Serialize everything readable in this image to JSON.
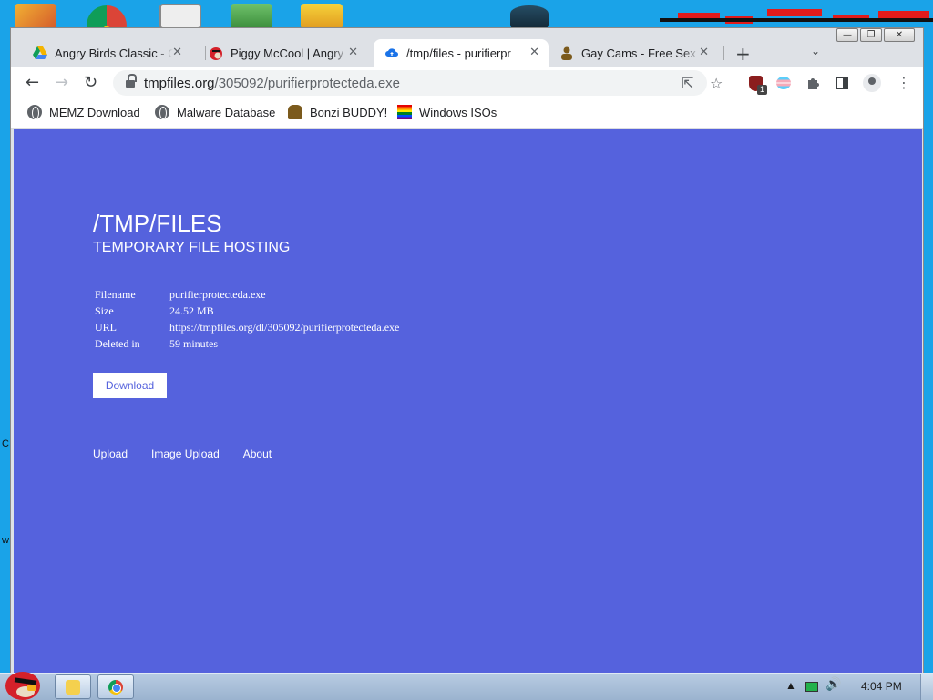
{
  "browser": {
    "tabs": [
      {
        "title": "Angry Birds Classic - G",
        "favicon": "google-drive-icon",
        "active": false
      },
      {
        "title": "Piggy McCool | Angry",
        "favicon": "red-bird-icon",
        "active": false
      },
      {
        "title": "/tmp/files - purifierpr",
        "favicon": "cloud-upload-icon",
        "active": true
      },
      {
        "title": "Gay Cams - Free Sex C",
        "favicon": "user-icon",
        "active": false
      }
    ],
    "close_glyph": "✕",
    "new_tab_glyph": "+",
    "tab_search_glyph": "⌄",
    "url_host": "tmpfiles.org",
    "url_path": "/305092/purifierprotecteda.exe",
    "bookmarks": [
      {
        "label": "MEMZ Download",
        "icon": "globe-icon"
      },
      {
        "label": "Malware Database",
        "icon": "globe-icon"
      },
      {
        "label": "Bonzi BUDDY!",
        "icon": "bonzi-icon"
      },
      {
        "label": "Windows ISOs",
        "icon": "rainbow-flag-icon"
      }
    ],
    "extension_badge": "1"
  },
  "page": {
    "title": "/TMP/FILES",
    "subtitle": "TEMPORARY FILE HOSTING",
    "info": [
      {
        "key": "Filename",
        "value": "purifierprotecteda.exe"
      },
      {
        "key": "Size",
        "value": "24.52 MB"
      },
      {
        "key": "URL",
        "value": "https://tmpfiles.org/dl/305092/purifierprotecteda.exe"
      },
      {
        "key": "Deleted in",
        "value": "59 minutes"
      }
    ],
    "download_label": "Download",
    "footer_links": [
      "Upload",
      "Image Upload",
      "About"
    ],
    "background_color": "#5562dd"
  },
  "desktop": {
    "side_letters": [
      "C",
      "w"
    ]
  },
  "taskbar": {
    "clock": "4:04 PM"
  }
}
